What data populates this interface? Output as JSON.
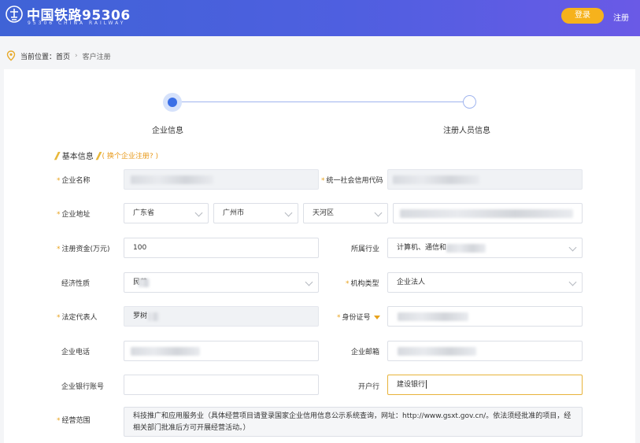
{
  "header": {
    "brand_title": "中国铁路95306",
    "brand_subtitle": "95306  CHINA  RAILWAY",
    "login_label": "登录",
    "register_label": "注册"
  },
  "breadcrumb": {
    "prefix": "当前位置：",
    "home": "首页",
    "current": "客户注册"
  },
  "steps": [
    {
      "label": "企业信息",
      "active": true
    },
    {
      "label": "注册人员信息",
      "active": false
    }
  ],
  "section": {
    "title": "基本信息",
    "link": "( 换个企业注册? )"
  },
  "form": {
    "company_name": {
      "label": "企业名称",
      "required": true,
      "value": ""
    },
    "credit_code": {
      "label": "统一社会信用代码",
      "required": true,
      "value": ""
    },
    "address": {
      "label": "企业地址",
      "required": true,
      "province": "广东省",
      "city": "广州市",
      "district": "天河区",
      "detail": ""
    },
    "capital": {
      "label": "注册资金(万元)",
      "required": true,
      "value": "100"
    },
    "industry": {
      "label": "所属行业",
      "required": false,
      "value": "计算机、通信和"
    },
    "economic_nature": {
      "label": "经济性质",
      "required": false,
      "value": "民营"
    },
    "org_type": {
      "label": "机构类型",
      "required": true,
      "value": "企业法人"
    },
    "legal_rep": {
      "label": "法定代表人",
      "required": true,
      "value": "罗树"
    },
    "id_type": {
      "label": "身份证号",
      "required": true,
      "value": ""
    },
    "phone": {
      "label": "企业电话",
      "required": false,
      "value": ""
    },
    "email": {
      "label": "企业邮箱",
      "required": false,
      "value": ""
    },
    "bank_account": {
      "label": "企业银行账号",
      "required": false,
      "value": ""
    },
    "bank": {
      "label": "开户行",
      "required": false,
      "value": "建设银行"
    },
    "scope": {
      "label": "经营范围",
      "required": true,
      "value": "科技推广和应用服务业（具体经营项目请登录国家企业信用信息公示系统查询，网址：http://www.gsxt.gov.cn/。依法须经批准的项目，经相关部门批准后方可开展经营活动。）"
    }
  },
  "colors": {
    "header_start": "#3f63d6",
    "header_end": "#6a5ae6",
    "accent": "#f6b21c",
    "step_active": "#3b6fe6",
    "required": "#e8a21c"
  }
}
